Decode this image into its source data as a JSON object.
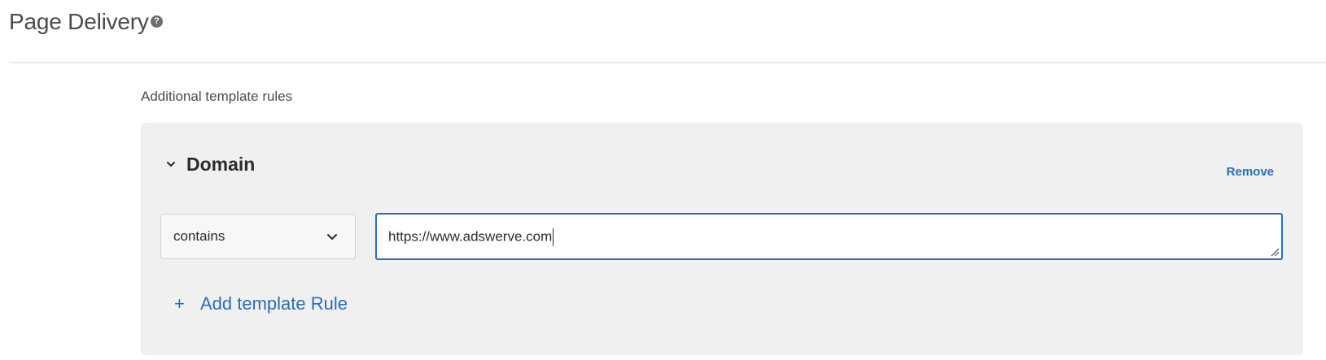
{
  "header": {
    "title": "Page Delivery",
    "help_icon": "question-circle-icon"
  },
  "section": {
    "label": "Additional template rules"
  },
  "rule": {
    "title": "Domain",
    "toggle_icon": "chevron-down-icon",
    "remove_label": "Remove",
    "operator": {
      "selected": "contains",
      "icon": "chevron-down-icon"
    },
    "value": "https://www.adswerve.com"
  },
  "add_rule": {
    "icon": "plus-icon",
    "icon_glyph": "+",
    "label": "Add template Rule"
  },
  "colors": {
    "accent": "#2d6db5",
    "panel_background": "#f0f0f0",
    "text": "#2c2c2c"
  }
}
